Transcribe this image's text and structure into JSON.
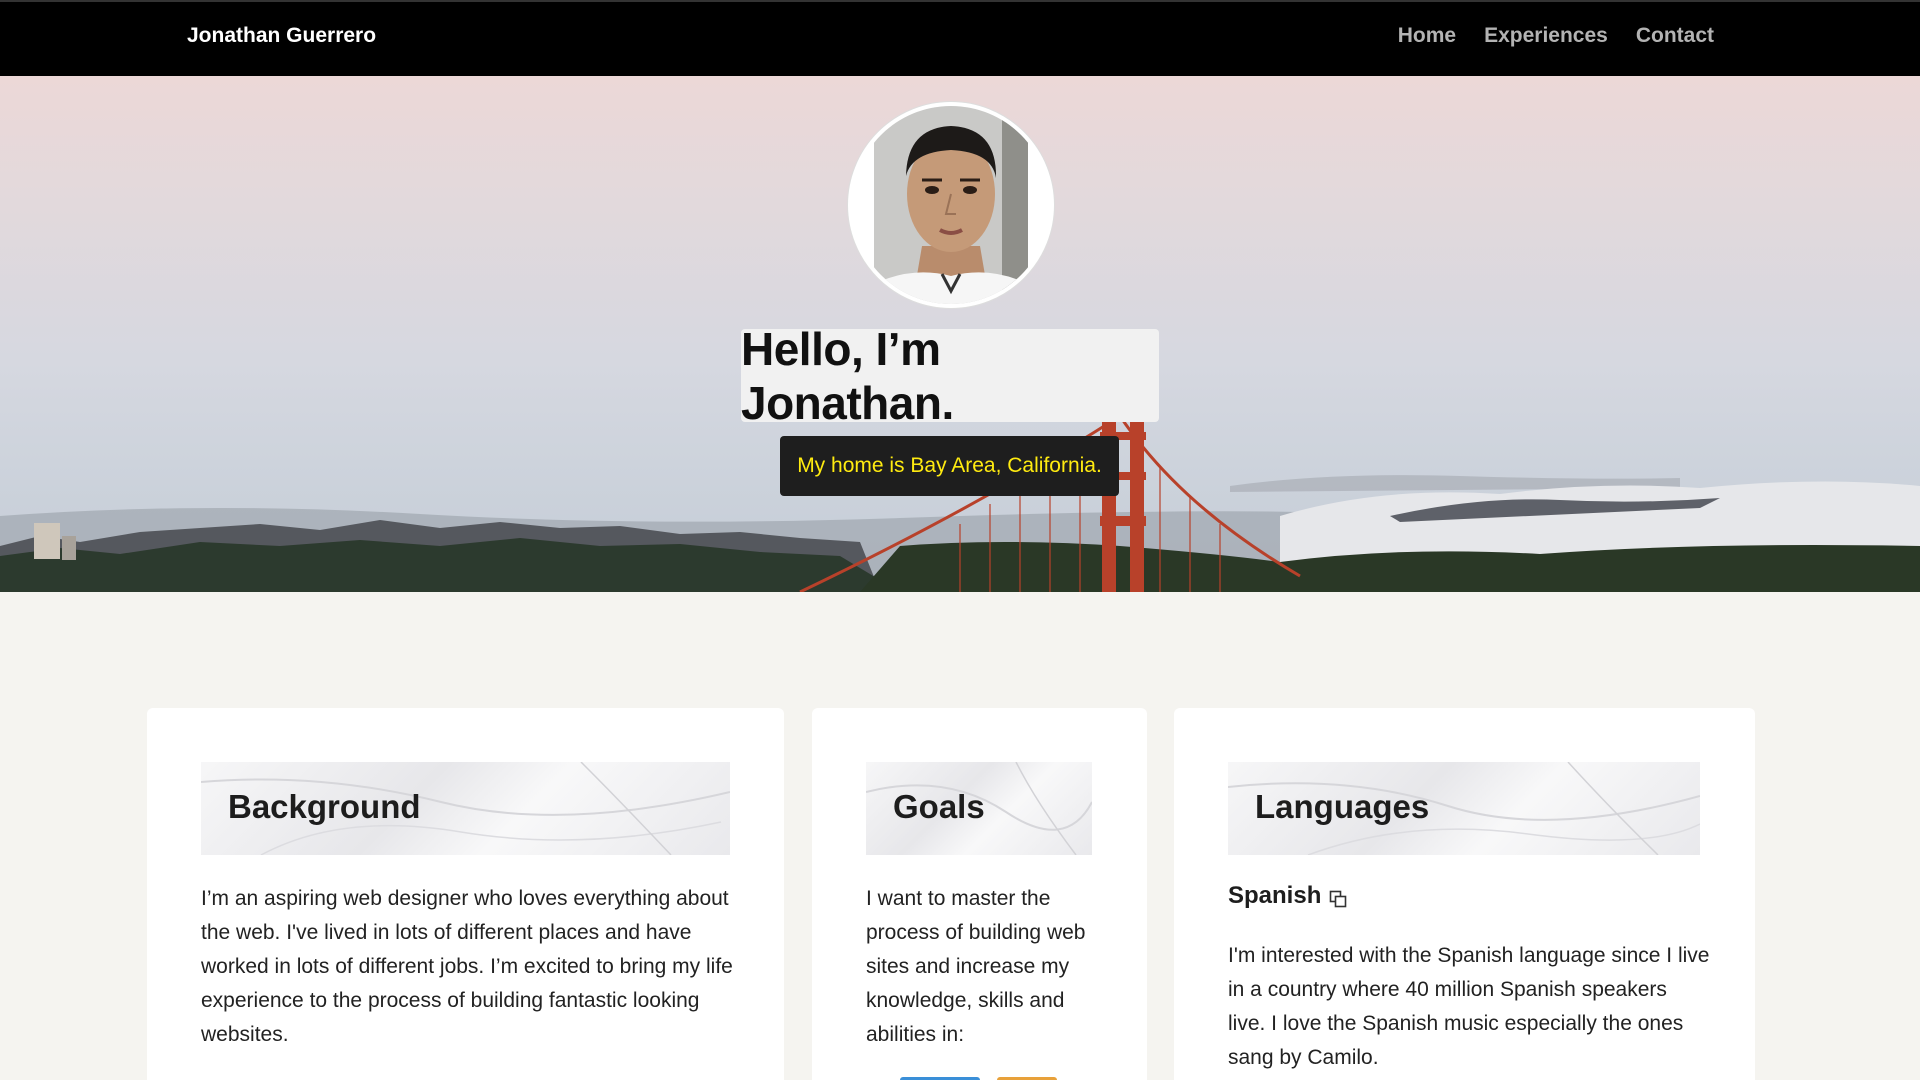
{
  "nav": {
    "brand": "Jonathan Guerrero",
    "links": [
      "Home",
      "Experiences",
      "Contact"
    ]
  },
  "hero": {
    "greeting": "Hello, I’m Jonathan.",
    "home": "My home is Bay Area, California."
  },
  "cards": {
    "background": {
      "title": "Background",
      "text": "I’m an aspiring web designer who loves everything about the web. I've lived in lots of different places and have worked in lots of different jobs. I’m excited to bring my life experience to the process of building fantastic looking websites."
    },
    "goals": {
      "title": "Goals",
      "text": "I want to master the process of building web sites and increase my knowledge, skills and abilities in:"
    },
    "languages": {
      "title": "Languages",
      "language_name": "Spanish",
      "text": "I'm interested with the Spanish language since I live in a country where 40 million Spanish speakers live. I love the Spanish music especially the ones sang by Camilo."
    }
  },
  "colors": {
    "nav_bg": "#000000",
    "nav_link": "#b3b3b3",
    "home_text": "#ffeb10",
    "page_bg": "#f5f4f0",
    "bridge": "#b8412a",
    "badge_blue": "#3a8fd8",
    "badge_orange": "#e8a13a"
  },
  "icons": {
    "copy": "copy-icon"
  }
}
